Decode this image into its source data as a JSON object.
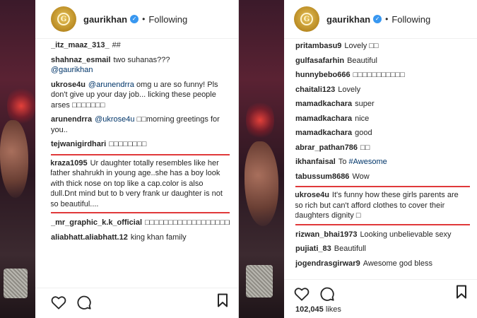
{
  "left_panel": {
    "header": {
      "username": "gaurikhan",
      "separator": "•",
      "follow_status": "Following"
    },
    "comments": [
      {
        "user": "_itz_maaz_313_",
        "text": "##"
      },
      {
        "user": "shahnaz_esmail",
        "text": "two suhanas???",
        "mention": "@gaurikhan"
      },
      {
        "user": "ukrose4u",
        "mention": "@arunendrra",
        "text": "omg u are so funny! Pls don't give up your day job... licking these people arses □□□□□□□"
      },
      {
        "user": "arunendrra",
        "mention": "@ukrose4u",
        "text": "□□morning greetings for you.."
      },
      {
        "user": "tejwanigirdhari",
        "text": "□□□□□□□□"
      },
      {
        "user": "kraza1095",
        "text": "Ur daughter totally resembles like her father shahrukh in young age..she has a boy look with thick nose on top like a cap.color is also dull.Dnt mind but to b very frank ur daughter is not so beautiful....",
        "highlighted": true
      },
      {
        "user": "_mr_graphic_k.k_official",
        "text": "□□□□□□□□□□□□□□□□□□□□□□□□□□□□□□□□□□□□□□□□□□□□□□"
      },
      {
        "user": "aliabhatt.aliabhatt.12",
        "text": "king khan family"
      }
    ]
  },
  "right_panel": {
    "header": {
      "username": "gaurikhan",
      "separator": "•",
      "follow_status": "Following"
    },
    "comments": [
      {
        "user": "pritambasu9",
        "text": "Lovely □□"
      },
      {
        "user": "gulfasafarhin",
        "text": "Beautiful"
      },
      {
        "user": "hunnybebo666",
        "text": "□□□□□□□□□□□"
      },
      {
        "user": "chaitali123",
        "text": "Lovely"
      },
      {
        "user": "mamadkachara",
        "text": "super"
      },
      {
        "user": "mamadkachara",
        "text": "nice"
      },
      {
        "user": "mamadkachara",
        "text": "good"
      },
      {
        "user": "abrar_pathan786",
        "text": "□□"
      },
      {
        "user": "ikhanfaisal",
        "text": "To",
        "mention": "#Awesome"
      },
      {
        "user": "tabussum8686",
        "text": "Wow"
      },
      {
        "user": "ukrose4u",
        "text": "It's funny how these girls parents are so rich but can't afford clothes to cover their daughters dignity □",
        "highlighted": true
      },
      {
        "user": "rizwan_bhai1973",
        "text": "Looking unbelievable sexy"
      },
      {
        "user": "pujiati_83",
        "text": "Beautifull"
      },
      {
        "user": "jogendrasgirwar9",
        "text": "Awesome god bless"
      }
    ],
    "likes": {
      "count": "102,045",
      "word": "likes"
    }
  },
  "icons": [
    "heart-icon",
    "comment-icon",
    "bookmark-icon",
    "verified-badge-icon",
    "avatar-logo"
  ],
  "colors": {
    "highlight_border": "#e0393a",
    "verified_blue": "#3897f0",
    "mention_blue": "#003569",
    "avatar_gold": "#b98a22"
  }
}
